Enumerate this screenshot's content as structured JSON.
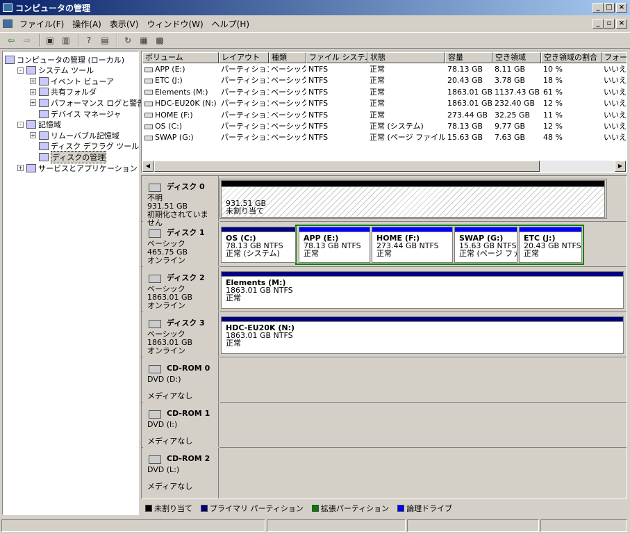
{
  "window": {
    "title": "コンピュータの管理",
    "min": "_",
    "max": "□",
    "close": "×"
  },
  "menu": [
    "ファイル(F)",
    "操作(A)",
    "表示(V)",
    "ウィンドウ(W)",
    "ヘルプ(H)"
  ],
  "tree": [
    {
      "label": "コンピュータの管理 (ローカル)",
      "level": 0,
      "expander": ""
    },
    {
      "label": "システム ツール",
      "level": 1,
      "expander": "-"
    },
    {
      "label": "イベント ビューア",
      "level": 2,
      "expander": "+"
    },
    {
      "label": "共有フォルダ",
      "level": 2,
      "expander": "+"
    },
    {
      "label": "パフォーマンス ログと警告",
      "level": 2,
      "expander": "+"
    },
    {
      "label": "デバイス マネージャ",
      "level": 2,
      "expander": ""
    },
    {
      "label": "記憶域",
      "level": 1,
      "expander": "-"
    },
    {
      "label": "リムーバブル記憶域",
      "level": 2,
      "expander": "+"
    },
    {
      "label": "ディスク デフラグ ツール",
      "level": 2,
      "expander": ""
    },
    {
      "label": "ディスクの管理",
      "level": 2,
      "expander": "",
      "selected": true
    },
    {
      "label": "サービスとアプリケーション",
      "level": 1,
      "expander": "+"
    }
  ],
  "columns": [
    "ボリューム",
    "レイアウト",
    "種類",
    "ファイル システム",
    "状態",
    "容量",
    "空き領域",
    "空き領域の割合",
    "フォール"
  ],
  "volumes": [
    [
      "APP (E:)",
      "パーティション",
      "ベーシック",
      "NTFS",
      "正常",
      "78.13 GB",
      "8.11 GB",
      "10 %",
      "いいえ"
    ],
    [
      "ETC (J:)",
      "パーティション",
      "ベーシック",
      "NTFS",
      "正常",
      "20.43 GB",
      "3.78 GB",
      "18 %",
      "いいえ"
    ],
    [
      "Elements (M:)",
      "パーティション",
      "ベーシック",
      "NTFS",
      "正常",
      "1863.01 GB",
      "1137.43 GB",
      "61 %",
      "いいえ"
    ],
    [
      "HDC-EU20K (N:)",
      "パーティション",
      "ベーシック",
      "NTFS",
      "正常",
      "1863.01 GB",
      "232.40 GB",
      "12 %",
      "いいえ"
    ],
    [
      "HOME (F:)",
      "パーティション",
      "ベーシック",
      "NTFS",
      "正常",
      "273.44 GB",
      "32.25 GB",
      "11 %",
      "いいえ"
    ],
    [
      "OS (C:)",
      "パーティション",
      "ベーシック",
      "NTFS",
      "正常 (システム)",
      "78.13 GB",
      "9.77 GB",
      "12 %",
      "いいえ"
    ],
    [
      "SWAP (G:)",
      "パーティション",
      "ベーシック",
      "NTFS",
      "正常 (ページ ファイル)",
      "15.63 GB",
      "7.63 GB",
      "48 %",
      "いいえ"
    ]
  ],
  "disks": [
    {
      "name": "ディスク 0",
      "l1": "不明",
      "l2": "931.51 GB",
      "l3": "初期化されていません",
      "parts": [
        {
          "name": "",
          "size": "931.51 GB",
          "status": "未割り当て",
          "kind": "unalloc"
        }
      ]
    },
    {
      "name": "ディスク 1",
      "l1": "ベーシック",
      "l2": "465.75 GB",
      "l3": "オンライン",
      "parts": [
        {
          "name": "OS (C:)",
          "size": "78.13 GB NTFS",
          "status": "正常 (システム)",
          "kind": "primary"
        },
        {
          "name": "APP (E:)",
          "size": "78.13 GB NTFS",
          "status": "正常",
          "kind": "logical"
        },
        {
          "name": "HOME (F:)",
          "size": "273.44 GB NTFS",
          "status": "正常",
          "kind": "logical"
        },
        {
          "name": "SWAP (G:)",
          "size": "15.63 GB NTFS",
          "status": "正常 (ページ ファイル)",
          "kind": "logical"
        },
        {
          "name": "ETC (J:)",
          "size": "20.43 GB NTFS",
          "status": "正常",
          "kind": "logical"
        }
      ]
    },
    {
      "name": "ディスク 2",
      "l1": "ベーシック",
      "l2": "1863.01 GB",
      "l3": "オンライン",
      "parts": [
        {
          "name": "Elements (M:)",
          "size": "1863.01 GB NTFS",
          "status": "正常",
          "kind": "primary"
        }
      ]
    },
    {
      "name": "ディスク 3",
      "l1": "ベーシック",
      "l2": "1863.01 GB",
      "l3": "オンライン",
      "parts": [
        {
          "name": "HDC-EU20K (N:)",
          "size": "1863.01 GB NTFS",
          "status": "正常",
          "kind": "primary"
        }
      ]
    },
    {
      "name": "CD-ROM 0",
      "l1": "DVD (D:)",
      "l2": "",
      "l3": "メディアなし",
      "parts": []
    },
    {
      "name": "CD-ROM 1",
      "l1": "DVD (I:)",
      "l2": "",
      "l3": "メディアなし",
      "parts": []
    },
    {
      "name": "CD-ROM 2",
      "l1": "DVD (L:)",
      "l2": "",
      "l3": "メディアなし",
      "parts": []
    }
  ],
  "legend": [
    {
      "label": "未割り当て",
      "color": "#000000"
    },
    {
      "label": "プライマリ パーティション",
      "color": "#000080"
    },
    {
      "label": "拡張パーティション",
      "color": "#008000"
    },
    {
      "label": "論理ドライブ",
      "color": "#0000ff"
    }
  ],
  "colors": {
    "primary": "#000080",
    "logical": "#0000ff",
    "extended": "#008000",
    "unalloc": "#000000"
  }
}
